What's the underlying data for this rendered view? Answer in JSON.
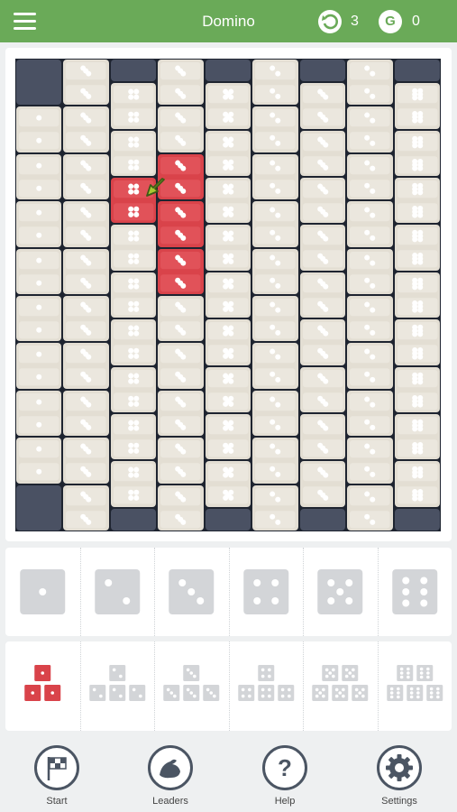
{
  "header": {
    "title": "Domino",
    "undo_count": "3",
    "gems_count": "0",
    "undo_icon": "undo-icon",
    "gems_icon_glyph": "G",
    "bg": "#6aaa58"
  },
  "board": {
    "columns": 9,
    "rows": 20,
    "colors": {
      "frame": "#1e2430",
      "cap": "#4a5163",
      "tile": "#e3ded3",
      "selected": "#d9434a",
      "pip": "#ffffff"
    },
    "tiles": [
      [
        0,
        0,
        2,
        "cap",
        0
      ],
      [
        0,
        2,
        2,
        "tile",
        1
      ],
      [
        0,
        4,
        2,
        "tile",
        1
      ],
      [
        0,
        6,
        2,
        "tile",
        1
      ],
      [
        0,
        8,
        2,
        "tile",
        1
      ],
      [
        0,
        10,
        2,
        "tile",
        1
      ],
      [
        0,
        12,
        2,
        "tile",
        1
      ],
      [
        0,
        14,
        2,
        "tile",
        1
      ],
      [
        0,
        16,
        2,
        "tile",
        1
      ],
      [
        0,
        18,
        2,
        "cap",
        0
      ],
      [
        1,
        0,
        2,
        "tile",
        3
      ],
      [
        1,
        2,
        2,
        "tile",
        3
      ],
      [
        1,
        4,
        2,
        "tile",
        3
      ],
      [
        1,
        6,
        2,
        "tile",
        3
      ],
      [
        1,
        8,
        2,
        "tile",
        3
      ],
      [
        1,
        10,
        2,
        "tile",
        3
      ],
      [
        1,
        12,
        2,
        "tile",
        3
      ],
      [
        1,
        14,
        2,
        "tile",
        3
      ],
      [
        1,
        16,
        2,
        "tile",
        3
      ],
      [
        1,
        18,
        2,
        "tile",
        3
      ],
      [
        2,
        0,
        1,
        "cap",
        0
      ],
      [
        2,
        1,
        2,
        "tile",
        4
      ],
      [
        2,
        3,
        2,
        "tile",
        4
      ],
      [
        2,
        5,
        2,
        "sel",
        4
      ],
      [
        2,
        7,
        2,
        "tile",
        4
      ],
      [
        2,
        9,
        2,
        "tile",
        4
      ],
      [
        2,
        11,
        2,
        "tile",
        4
      ],
      [
        2,
        13,
        2,
        "tile",
        4
      ],
      [
        2,
        15,
        2,
        "tile",
        4
      ],
      [
        2,
        17,
        2,
        "tile",
        4
      ],
      [
        2,
        19,
        1,
        "cap",
        0
      ],
      [
        3,
        0,
        2,
        "tile",
        3
      ],
      [
        3,
        2,
        2,
        "tile",
        3
      ],
      [
        3,
        4,
        2,
        "sel",
        3
      ],
      [
        3,
        6,
        2,
        "sel",
        3
      ],
      [
        3,
        8,
        2,
        "sel",
        3
      ],
      [
        3,
        10,
        2,
        "tile",
        3
      ],
      [
        3,
        12,
        2,
        "tile",
        3
      ],
      [
        3,
        14,
        2,
        "tile",
        3
      ],
      [
        3,
        16,
        2,
        "tile",
        3
      ],
      [
        3,
        18,
        2,
        "tile",
        3
      ],
      [
        4,
        0,
        1,
        "cap",
        0
      ],
      [
        4,
        1,
        2,
        "tile",
        5
      ],
      [
        4,
        3,
        2,
        "tile",
        5
      ],
      [
        4,
        5,
        2,
        "tile",
        5
      ],
      [
        4,
        7,
        2,
        "tile",
        5
      ],
      [
        4,
        9,
        2,
        "tile",
        5
      ],
      [
        4,
        11,
        2,
        "tile",
        5
      ],
      [
        4,
        13,
        2,
        "tile",
        5
      ],
      [
        4,
        15,
        2,
        "tile",
        5
      ],
      [
        4,
        17,
        2,
        "tile",
        5
      ],
      [
        4,
        19,
        1,
        "cap",
        0
      ],
      [
        5,
        0,
        2,
        "tile",
        2
      ],
      [
        5,
        2,
        2,
        "tile",
        2
      ],
      [
        5,
        4,
        2,
        "tile",
        2
      ],
      [
        5,
        6,
        2,
        "tile",
        2
      ],
      [
        5,
        8,
        2,
        "tile",
        2
      ],
      [
        5,
        10,
        2,
        "tile",
        2
      ],
      [
        5,
        12,
        2,
        "tile",
        2
      ],
      [
        5,
        14,
        2,
        "tile",
        2
      ],
      [
        5,
        16,
        2,
        "tile",
        2
      ],
      [
        5,
        18,
        2,
        "tile",
        2
      ],
      [
        6,
        0,
        1,
        "cap",
        0
      ],
      [
        6,
        1,
        2,
        "tile",
        3
      ],
      [
        6,
        3,
        2,
        "tile",
        3
      ],
      [
        6,
        5,
        2,
        "tile",
        3
      ],
      [
        6,
        7,
        2,
        "tile",
        3
      ],
      [
        6,
        9,
        2,
        "tile",
        3
      ],
      [
        6,
        11,
        2,
        "tile",
        3
      ],
      [
        6,
        13,
        2,
        "tile",
        3
      ],
      [
        6,
        15,
        2,
        "tile",
        3
      ],
      [
        6,
        17,
        2,
        "tile",
        3
      ],
      [
        6,
        19,
        1,
        "cap",
        0
      ],
      [
        7,
        0,
        2,
        "tile",
        2
      ],
      [
        7,
        2,
        2,
        "tile",
        2
      ],
      [
        7,
        4,
        2,
        "tile",
        2
      ],
      [
        7,
        6,
        2,
        "tile",
        2
      ],
      [
        7,
        8,
        2,
        "tile",
        2
      ],
      [
        7,
        10,
        2,
        "tile",
        2
      ],
      [
        7,
        12,
        2,
        "tile",
        2
      ],
      [
        7,
        14,
        2,
        "tile",
        2
      ],
      [
        7,
        16,
        2,
        "tile",
        2
      ],
      [
        7,
        18,
        2,
        "tile",
        2
      ],
      [
        8,
        0,
        1,
        "cap",
        0
      ],
      [
        8,
        1,
        2,
        "tile",
        6
      ],
      [
        8,
        3,
        2,
        "tile",
        6
      ],
      [
        8,
        5,
        2,
        "tile",
        6
      ],
      [
        8,
        7,
        2,
        "tile",
        6
      ],
      [
        8,
        9,
        2,
        "tile",
        6
      ],
      [
        8,
        11,
        2,
        "tile",
        6
      ],
      [
        8,
        13,
        2,
        "tile",
        6
      ],
      [
        8,
        15,
        2,
        "tile",
        6
      ],
      [
        8,
        17,
        2,
        "tile",
        6
      ],
      [
        8,
        19,
        1,
        "cap",
        0
      ]
    ]
  },
  "dice_tray": {
    "faces": [
      1,
      2,
      3,
      4,
      5,
      6
    ],
    "colors": {
      "face": "#d3d5d8",
      "pip": "#ffffff"
    }
  },
  "pyramid_tray": {
    "levels": [
      1,
      2,
      3,
      4,
      5,
      6
    ],
    "active_index": 0,
    "colors": {
      "active": "#d9434a",
      "inactive": "#d3d5d8"
    }
  },
  "bottom_nav": [
    {
      "label": "Start",
      "icon": "checkered-flag-icon"
    },
    {
      "label": "Leaders",
      "icon": "flexed-arm-icon"
    },
    {
      "label": "Help",
      "icon": "question-mark-icon"
    },
    {
      "label": "Settings",
      "icon": "gear-icon"
    }
  ]
}
